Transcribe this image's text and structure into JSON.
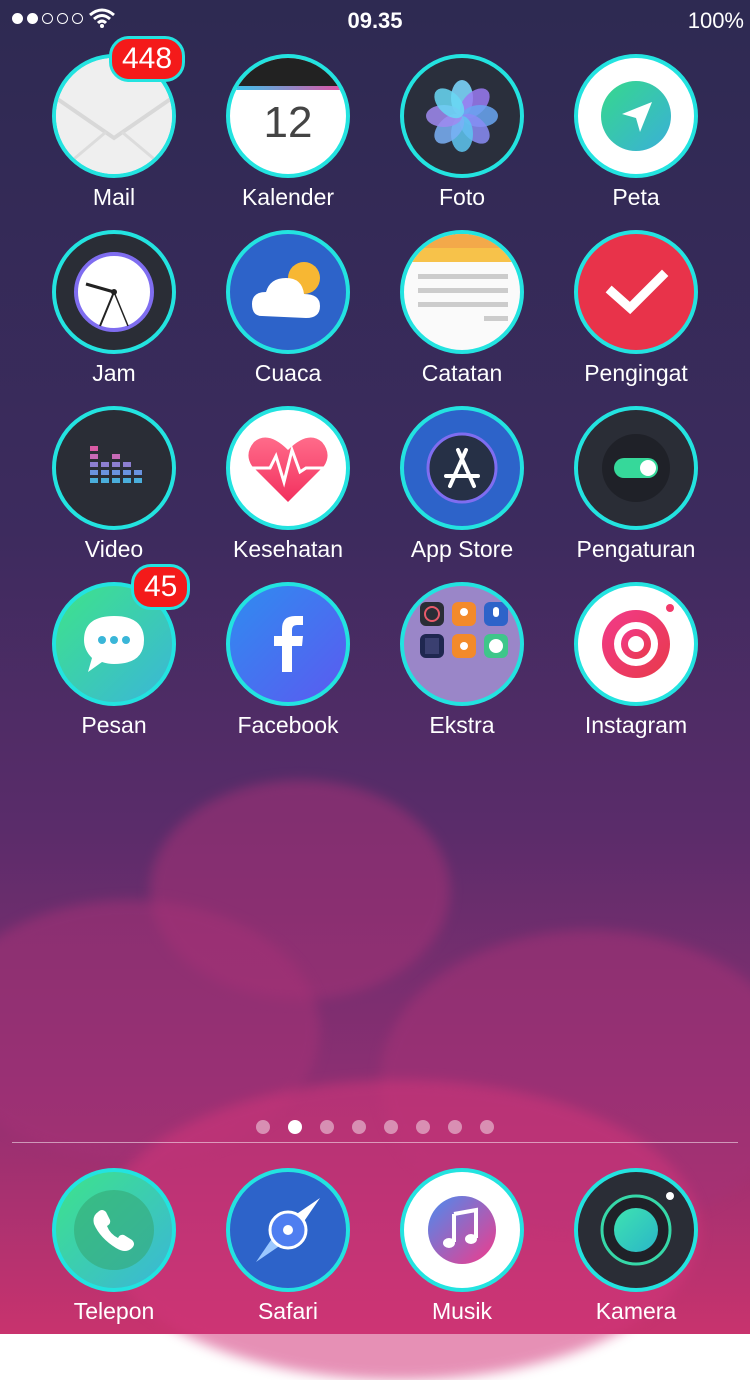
{
  "status": {
    "time": "09.35",
    "battery": "100%",
    "signal_bars_filled": 2,
    "signal_bars_total": 5
  },
  "apps": {
    "mail": {
      "label": "Mail",
      "badge": "448"
    },
    "kalender": {
      "label": "Kalender",
      "day": "12"
    },
    "foto": {
      "label": "Foto"
    },
    "peta": {
      "label": "Peta"
    },
    "jam": {
      "label": "Jam"
    },
    "cuaca": {
      "label": "Cuaca"
    },
    "catatan": {
      "label": "Catatan"
    },
    "pengingat": {
      "label": "Pengingat"
    },
    "video": {
      "label": "Video"
    },
    "kesehatan": {
      "label": "Kesehatan"
    },
    "appstore": {
      "label": "App Store"
    },
    "pengaturan": {
      "label": "Pengaturan"
    },
    "pesan": {
      "label": "Pesan",
      "badge": "45"
    },
    "facebook": {
      "label": "Facebook"
    },
    "ekstra": {
      "label": "Ekstra"
    },
    "instagram": {
      "label": "Instagram"
    }
  },
  "page_indicator": {
    "count": 8,
    "active_index": 1
  },
  "dock": {
    "telepon": {
      "label": "Telepon"
    },
    "safari": {
      "label": "Safari"
    },
    "musik": {
      "label": "Musik"
    },
    "kamera": {
      "label": "Kamera"
    }
  },
  "colors": {
    "ring": "#23e3e0",
    "badge": "#f41a1a",
    "accent_red": "#e8334a"
  }
}
